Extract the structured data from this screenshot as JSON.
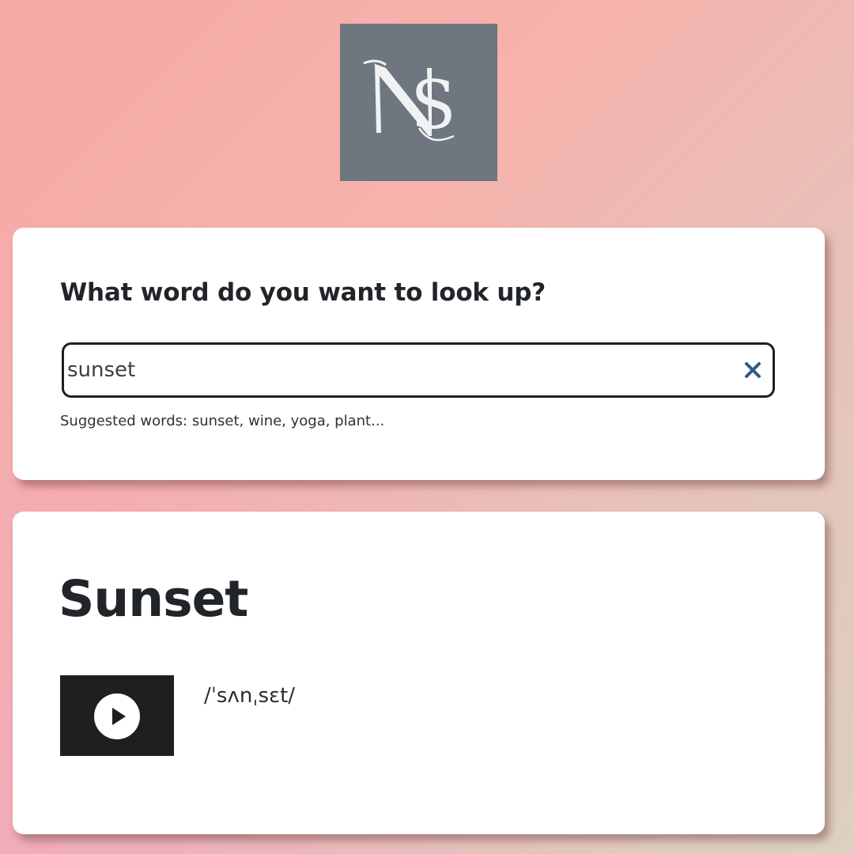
{
  "logo": {
    "text": "NS",
    "background": "#6e767f"
  },
  "search": {
    "prompt": "What word do you want to look up?",
    "value": "sunset",
    "placeholder": "",
    "clear_icon": "close-icon",
    "hint": "Suggested words: sunset, wine, yoga, plant..."
  },
  "result": {
    "word": "Sunset",
    "phonetic": "/ˈsʌnˌsɛt/",
    "audio_icon": "play-icon"
  },
  "colors": {
    "accent": "#2d5b86",
    "card": "#ffffff",
    "player": "#1f1f1f"
  }
}
